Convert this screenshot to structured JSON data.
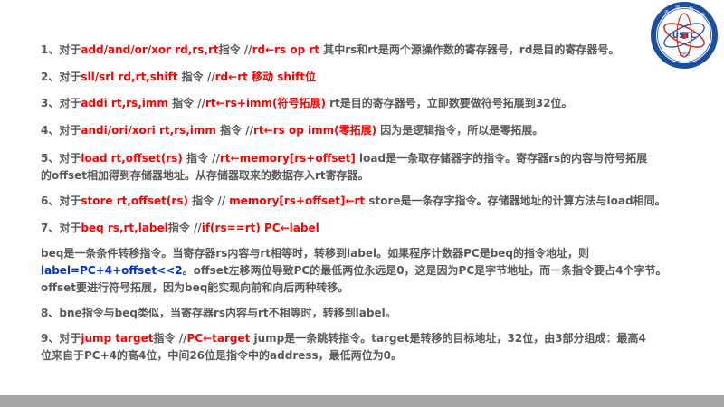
{
  "logo": {
    "acronym": "USTC",
    "year": "1958",
    "ring_text": "中 国 科 学 技 术 大 学",
    "colors": {
      "ring": "#1a4fa0",
      "orbit": "#d9342b"
    }
  },
  "colors": {
    "keyword": "#ff0000",
    "formula": "#0033cc",
    "body": "#595959",
    "footer": "#a6a6a6"
  },
  "items": {
    "i1": {
      "prefix": "1、对于",
      "instr": "add/and/or/xor  rd,rs,rt",
      "mid": "指令  //",
      "rtl": "rd←rs  op  rt",
      "desc": "  其中rs和rt是两个源操作数的寄存器号，rd是目的寄存器号。"
    },
    "i2": {
      "prefix": "2、对于",
      "instr": "sll/srl  rd,rt,shift",
      "mid": " 指令  //",
      "rtl": "rd←rt  移动  shift位"
    },
    "i3": {
      "prefix": "3、对于",
      "instr": "addi  rt,rs,imm",
      "mid": " 指令  //",
      "rtl": "rt←rs+imm(符号拓展)",
      "desc": "  rt是目的寄存器号，立即数要做符号拓展到32位。"
    },
    "i4": {
      "prefix": "4、对于",
      "instr": "andi/ori/xori  rt,rs,imm",
      "mid": " 指令  //",
      "rtl": "rt←rs  op  imm(零拓展)",
      "desc": " 因为是逻辑指令，所以是零拓展。"
    },
    "i5": {
      "prefix": "5、对于",
      "instr": "load  rt,offset(rs)",
      "mid": "  指令  //",
      "rtl": "rt←memory[rs+offset]",
      "desc1": "  load是一条取存储器字的指令。寄存器rs的内容与符号拓展",
      "desc2": "的offset相加得到存储器地址。从存储器取来的数据存入rt寄存器。"
    },
    "i6": {
      "prefix": "6、对于",
      "instr": "store  rt,offset(rs)",
      "mid": "  指令  // ",
      "rtl": "memory[rs+offset]←rt",
      "desc": "  store是一条存字指令。存储器地址的计算方法与load相同。"
    },
    "i7": {
      "prefix": "7、对于",
      "instr": "beq  rs,rt,label",
      "mid": "指令  //",
      "rtl": "if(rs==rt)  PC←label",
      "p1": "beq是一条条件转移指令。当寄存器rs内容与rt相等时，转移到label。如果程序计数器PC是beq的指令地址，则",
      "formula": "label=PC+4+offset<<2",
      "p2": "。offset左移两位导致PC的最低两位永远是0，这是因为PC是字节地址，而一条指令要占4个字节。",
      "p3": "offset要进行符号拓展，因为beq能实现向前和向后两种转移。"
    },
    "i8": {
      "text": "8、bne指令与beq类似，当寄存器rs内容与rt不相等时，转移到label。"
    },
    "i9": {
      "prefix": "9、对于",
      "instr": "jump  target",
      "mid": "指令  //",
      "rtl": "PC←target",
      "desc1": "  jump是一条跳转指令。target是转移的目标地址，32位，由3部分组成：最高4",
      "desc2": "位来自于PC+4的高4位，中间26位是指令中的address，最低两位为0。"
    }
  }
}
